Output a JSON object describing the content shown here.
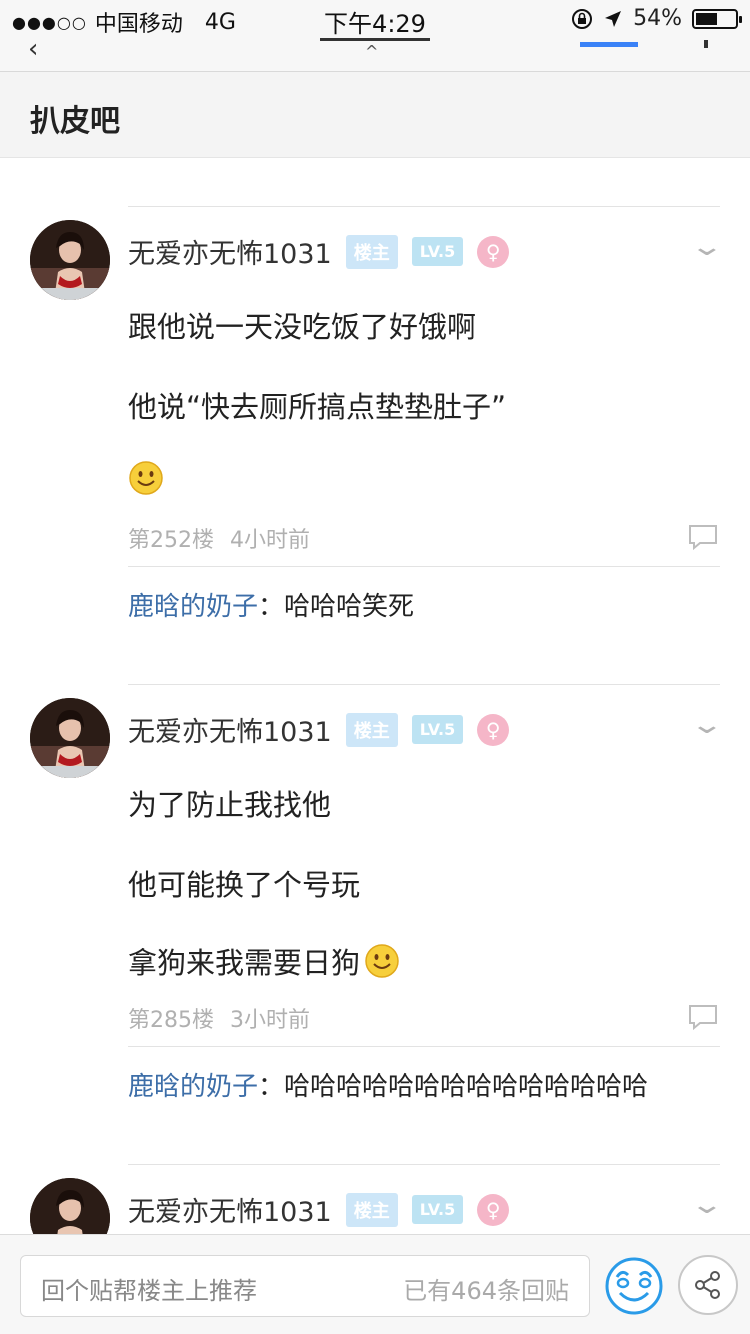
{
  "status_bar": {
    "carrier": "中国移动",
    "network": "4G",
    "time": "下午4:29",
    "battery": "54%",
    "battery_level": 0.54
  },
  "forum": {
    "name": "扒皮吧"
  },
  "posts": [
    {
      "author": "无爱亦无怖1031",
      "badge_owner": "楼主",
      "badge_level": "LV.5",
      "badge_gender": "♀",
      "lines": [
        "跟他说一天没吃饭了好饿啊",
        "他说“快去厕所搞点垫垫肚子”"
      ],
      "floor": "第252楼",
      "time": "4小时前",
      "reply": {
        "name": "鹿晗的奶子",
        "sep": "：",
        "text": "哈哈哈笑死"
      }
    },
    {
      "author": "无爱亦无怖1031",
      "badge_owner": "楼主",
      "badge_level": "LV.5",
      "badge_gender": "♀",
      "lines": [
        "为了防止我找他",
        "他可能换了个号玩",
        "拿狗来我需要日狗"
      ],
      "floor": "第285楼",
      "time": "3小时前",
      "reply": {
        "name": "鹿晗的奶子",
        "sep": "：",
        "text": "哈哈哈哈哈哈哈哈哈哈哈哈哈哈"
      }
    },
    {
      "author": "无爱亦无怖1031",
      "badge_owner": "楼主",
      "badge_level": "LV.5",
      "badge_gender": "♀"
    }
  ],
  "bottom_bar": {
    "placeholder": "回个贴帮楼主上推荐",
    "reply_count": "已有464条回贴"
  },
  "icons": {
    "smile": "smile-emoji-icon",
    "chevron": "chevron-down-icon",
    "comment": "comment-icon",
    "emoji": "emoji-icon",
    "share": "share-icon"
  }
}
